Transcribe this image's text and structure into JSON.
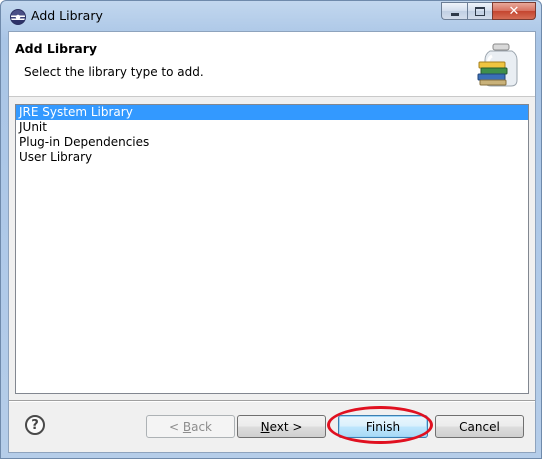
{
  "window": {
    "title": "Add Library"
  },
  "header": {
    "title": "Add Library",
    "description": "Select the library type to add."
  },
  "library_types": [
    {
      "label": "JRE System Library",
      "selected": true
    },
    {
      "label": "JUnit",
      "selected": false
    },
    {
      "label": "Plug-in Dependencies",
      "selected": false
    },
    {
      "label": "User Library",
      "selected": false
    }
  ],
  "buttons": {
    "help": "?",
    "back": {
      "prefix": "< ",
      "mnemonic": "B",
      "rest": "ack",
      "enabled": false
    },
    "next": {
      "mnemonic": "N",
      "rest": "ext >",
      "enabled": true
    },
    "finish": {
      "label": "Finish",
      "enabled": true,
      "default": true
    },
    "cancel": {
      "label": "Cancel",
      "enabled": true
    }
  },
  "colors": {
    "selection": "#3399ff",
    "highlight_ring": "#e01020"
  },
  "icons": {
    "title": "eclipse-icon",
    "header": "library-jar-icon",
    "help": "help-icon"
  }
}
